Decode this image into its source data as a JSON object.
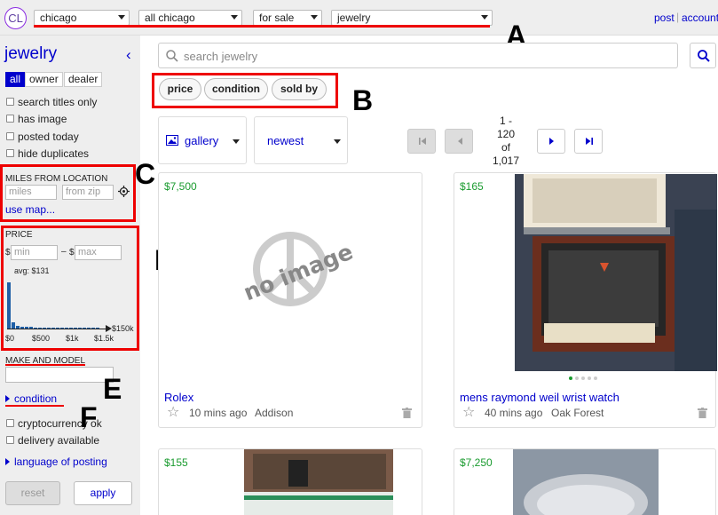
{
  "topbar": {
    "logo": "CL",
    "city": "chicago",
    "area": "all chicago",
    "section": "for sale",
    "category": "jewelry",
    "post_label": "post",
    "account_label": "account"
  },
  "sidebar": {
    "heading": "jewelry",
    "seller_types": [
      "all",
      "owner",
      "dealer"
    ],
    "checkboxes": [
      "search titles only",
      "has image",
      "posted today",
      "hide duplicates"
    ],
    "miles": {
      "label": "MILES FROM LOCATION",
      "miles_placeholder": "miles",
      "zip_placeholder": "from zip",
      "use_map": "use map..."
    },
    "price": {
      "label": "PRICE",
      "currency": "$",
      "min_placeholder": "min",
      "max_placeholder": "max",
      "dash": "–",
      "avg": "avg: $131",
      "ticks": [
        "$0",
        "$500",
        "$1k",
        "$1.5k"
      ],
      "end_label": "$150k",
      "histogram": [
        1.0,
        0.14,
        0.06,
        0.04,
        0.03,
        0.03,
        0.02,
        0.02,
        0.02,
        0.02,
        0.01,
        0.02,
        0.01,
        0.01,
        0.01,
        0.01,
        0.01,
        0.01,
        0.01,
        0.01,
        0.01
      ]
    },
    "make_model_label": "MAKE AND MODEL",
    "condition_label": "condition",
    "cb2": [
      "cryptocurrency ok",
      "delivery available"
    ],
    "language_label": "language of posting",
    "reset_label": "reset",
    "apply_label": "apply"
  },
  "main": {
    "search_placeholder": "search jewelry",
    "pills": [
      "price",
      "condition",
      "sold by"
    ],
    "view_label": "gallery",
    "sort_label": "newest",
    "pagination": {
      "line1": "1 -",
      "line2": "120",
      "line3": "of",
      "line4": "1,017"
    },
    "listings": [
      {
        "price": "$7,500",
        "no_image_text": "no image",
        "title": "Rolex",
        "time": "10 mins ago",
        "location": "Addison"
      },
      {
        "price": "$165",
        "title": "mens raymond weil wrist watch",
        "time": "40 mins ago",
        "location": "Oak Forest"
      },
      {
        "price": "$155"
      },
      {
        "price": "$7,250"
      }
    ]
  },
  "annotations": {
    "a": "A",
    "b": "B",
    "c": "C",
    "d": "D",
    "e": "E",
    "f": "F"
  },
  "colors": {
    "link": "#0000cc",
    "price": "#1a9b2f",
    "annotation": "#ee0000",
    "sidebar_bg": "#eeeeee"
  }
}
